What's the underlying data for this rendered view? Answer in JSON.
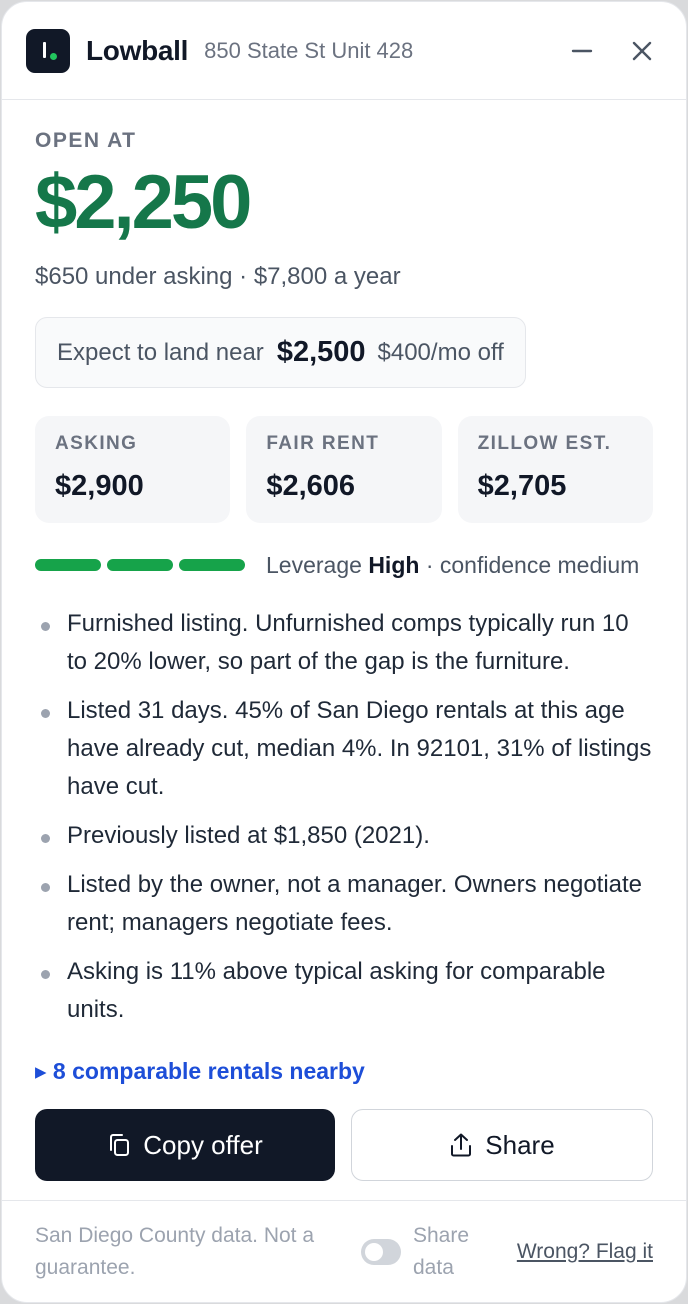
{
  "header": {
    "brand": "Lowball",
    "address": "850 State St Unit 428",
    "minimize_icon": "minus-icon",
    "close_icon": "close-icon"
  },
  "offer": {
    "open_label": "OPEN AT",
    "open_price": "$2,250",
    "subtitle": "$650 under asking · $7,800 a year",
    "expect_label": "Expect to land near",
    "expect_value": "$2,500",
    "expect_off": "$400/mo off"
  },
  "stats": [
    {
      "label": "ASKING",
      "value": "$2,900"
    },
    {
      "label": "FAIR RENT",
      "value": "$2,606"
    },
    {
      "label": "ZILLOW EST.",
      "value": "$2,705"
    }
  ],
  "leverage": {
    "prefix": "Leverage",
    "level": "High",
    "confidence": "· confidence medium",
    "segments_filled": 3,
    "segments_total": 3,
    "color": "#16a34a"
  },
  "bullets": [
    "Furnished listing. Unfurnished comps typically run 10 to 20% lower, so part of the gap is the furniture.",
    "Listed 31 days. 45% of San Diego rentals at this age have already cut, median 4%. In 92101, 31% of listings have cut.",
    "Previously listed at $1,850 (2021).",
    "Listed by the owner, not a manager. Owners negotiate rent; managers negotiate fees.",
    "Asking is 11% above typical asking for comparable units."
  ],
  "comps_link": "▸ 8 comparable rentals nearby",
  "actions": {
    "copy_label": "Copy offer",
    "copy_icon": "copy-icon",
    "share_label": "Share",
    "share_icon": "share-icon"
  },
  "footer": {
    "disclaimer": "San Diego County data. Not a guarantee.",
    "share_data_label": "Share data",
    "share_data_on": false,
    "flag_label": "Wrong? Flag it"
  },
  "colors": {
    "accent_green": "#15774a",
    "link_blue": "#1d4ed8",
    "dark": "#111827"
  }
}
